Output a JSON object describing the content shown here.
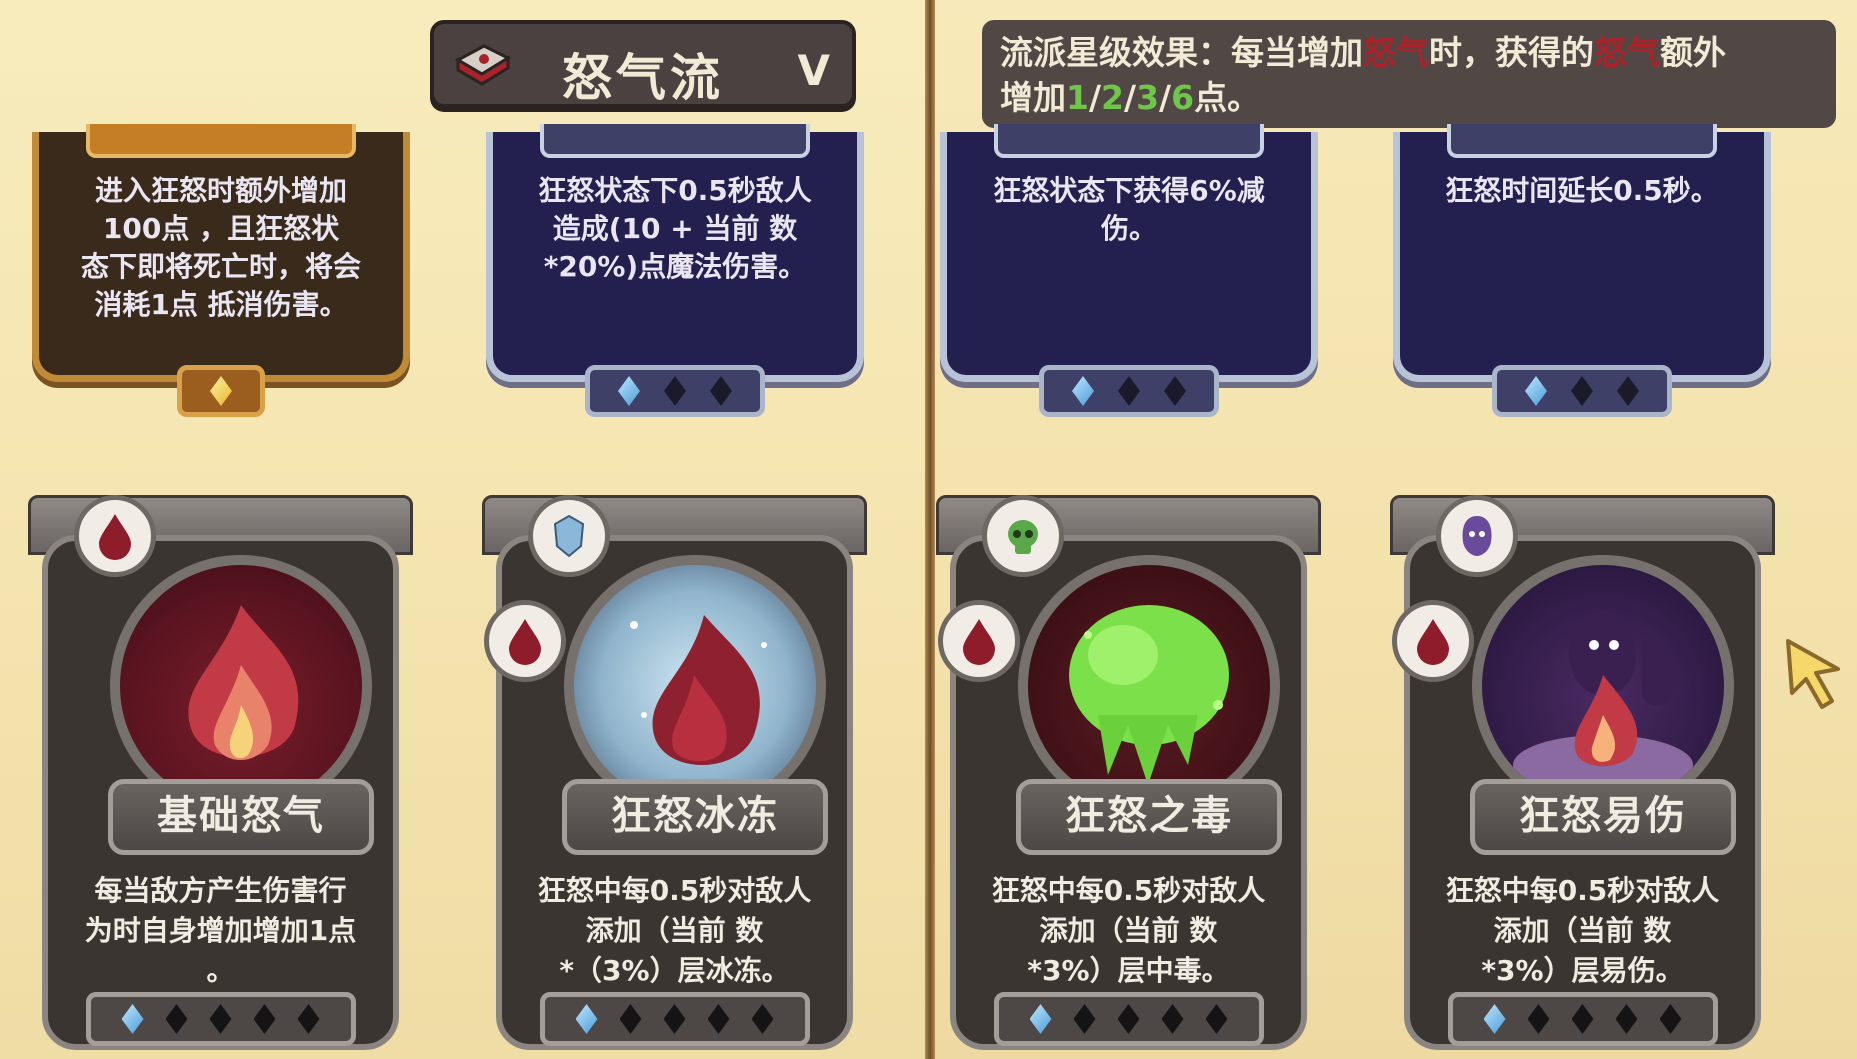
{
  "header": {
    "route_title": "怒气流",
    "dropdown_chevron": "V"
  },
  "tooltip": {
    "line1_a": "流派星级效果：每当增加",
    "line1_red1": "怒气",
    "line1_b": "时，获得的",
    "line1_red2": "怒气",
    "line1_c": "额外",
    "line2_a": "增加",
    "line2_v1": "1",
    "line2_s1": "/",
    "line2_v2": "2",
    "line2_s2": "/",
    "line2_v3": "3",
    "line2_s3": "/",
    "line2_v4": "6",
    "line2_b": "点。"
  },
  "top_cards": [
    {
      "style": "gold",
      "lines": [
        "进入狂怒时额外增加",
        "100点      ，且狂怒状",
        "态下即将死亡时，将会",
        "消耗1点      抵消伤害。"
      ],
      "gems": [
        1,
        0,
        0
      ],
      "gem_count": 1
    },
    {
      "style": "blue",
      "lines": [
        "狂怒状态下0.5秒敌人",
        "造成(10 + 当前      数",
        "*20%)点魔法伤害。"
      ],
      "gems_on": 1
    },
    {
      "style": "blue",
      "lines": [
        "狂怒状态下获得6%减",
        "伤。"
      ],
      "gems_on": 1
    },
    {
      "style": "blue",
      "lines": [
        "狂怒时间延长0.5秒。"
      ],
      "gems_on": 1
    }
  ],
  "bottom_cards": [
    {
      "name": "基础怒气",
      "lines": [
        "每当敌方产生伤害行",
        "为时自身增加增加1点",
        "      。"
      ],
      "icon": "rage-drop-icon",
      "portrait": "flame-portrait"
    },
    {
      "name": "狂怒冰冻",
      "lines": [
        "狂怒中每0.5秒对敌人",
        "添加（当前      数",
        "*（3%）层冰冻。"
      ],
      "icon": "ice-shield-icon",
      "portrait": "frost-flame-portrait"
    },
    {
      "name": "狂怒之毒",
      "lines": [
        "狂怒中每0.5秒对敌人",
        "添加（当前      数",
        "*3%）层中毒。"
      ],
      "icon": "skull-icon",
      "portrait": "poison-cloud-portrait"
    },
    {
      "name": "狂怒易伤",
      "lines": [
        "狂怒中每0.5秒对敌人",
        "添加（当前      数",
        "*3%）层易伤。"
      ],
      "icon": "ghost-icon",
      "portrait": "ghost-flame-portrait"
    }
  ],
  "colors": {
    "parchment": "#f6e7b4",
    "card_blue": "#232050",
    "card_gold": "#3a2a1c",
    "card_stone": "#3b3532",
    "accent_green": "#6fcf6a",
    "rage_red": "#a8242a"
  }
}
